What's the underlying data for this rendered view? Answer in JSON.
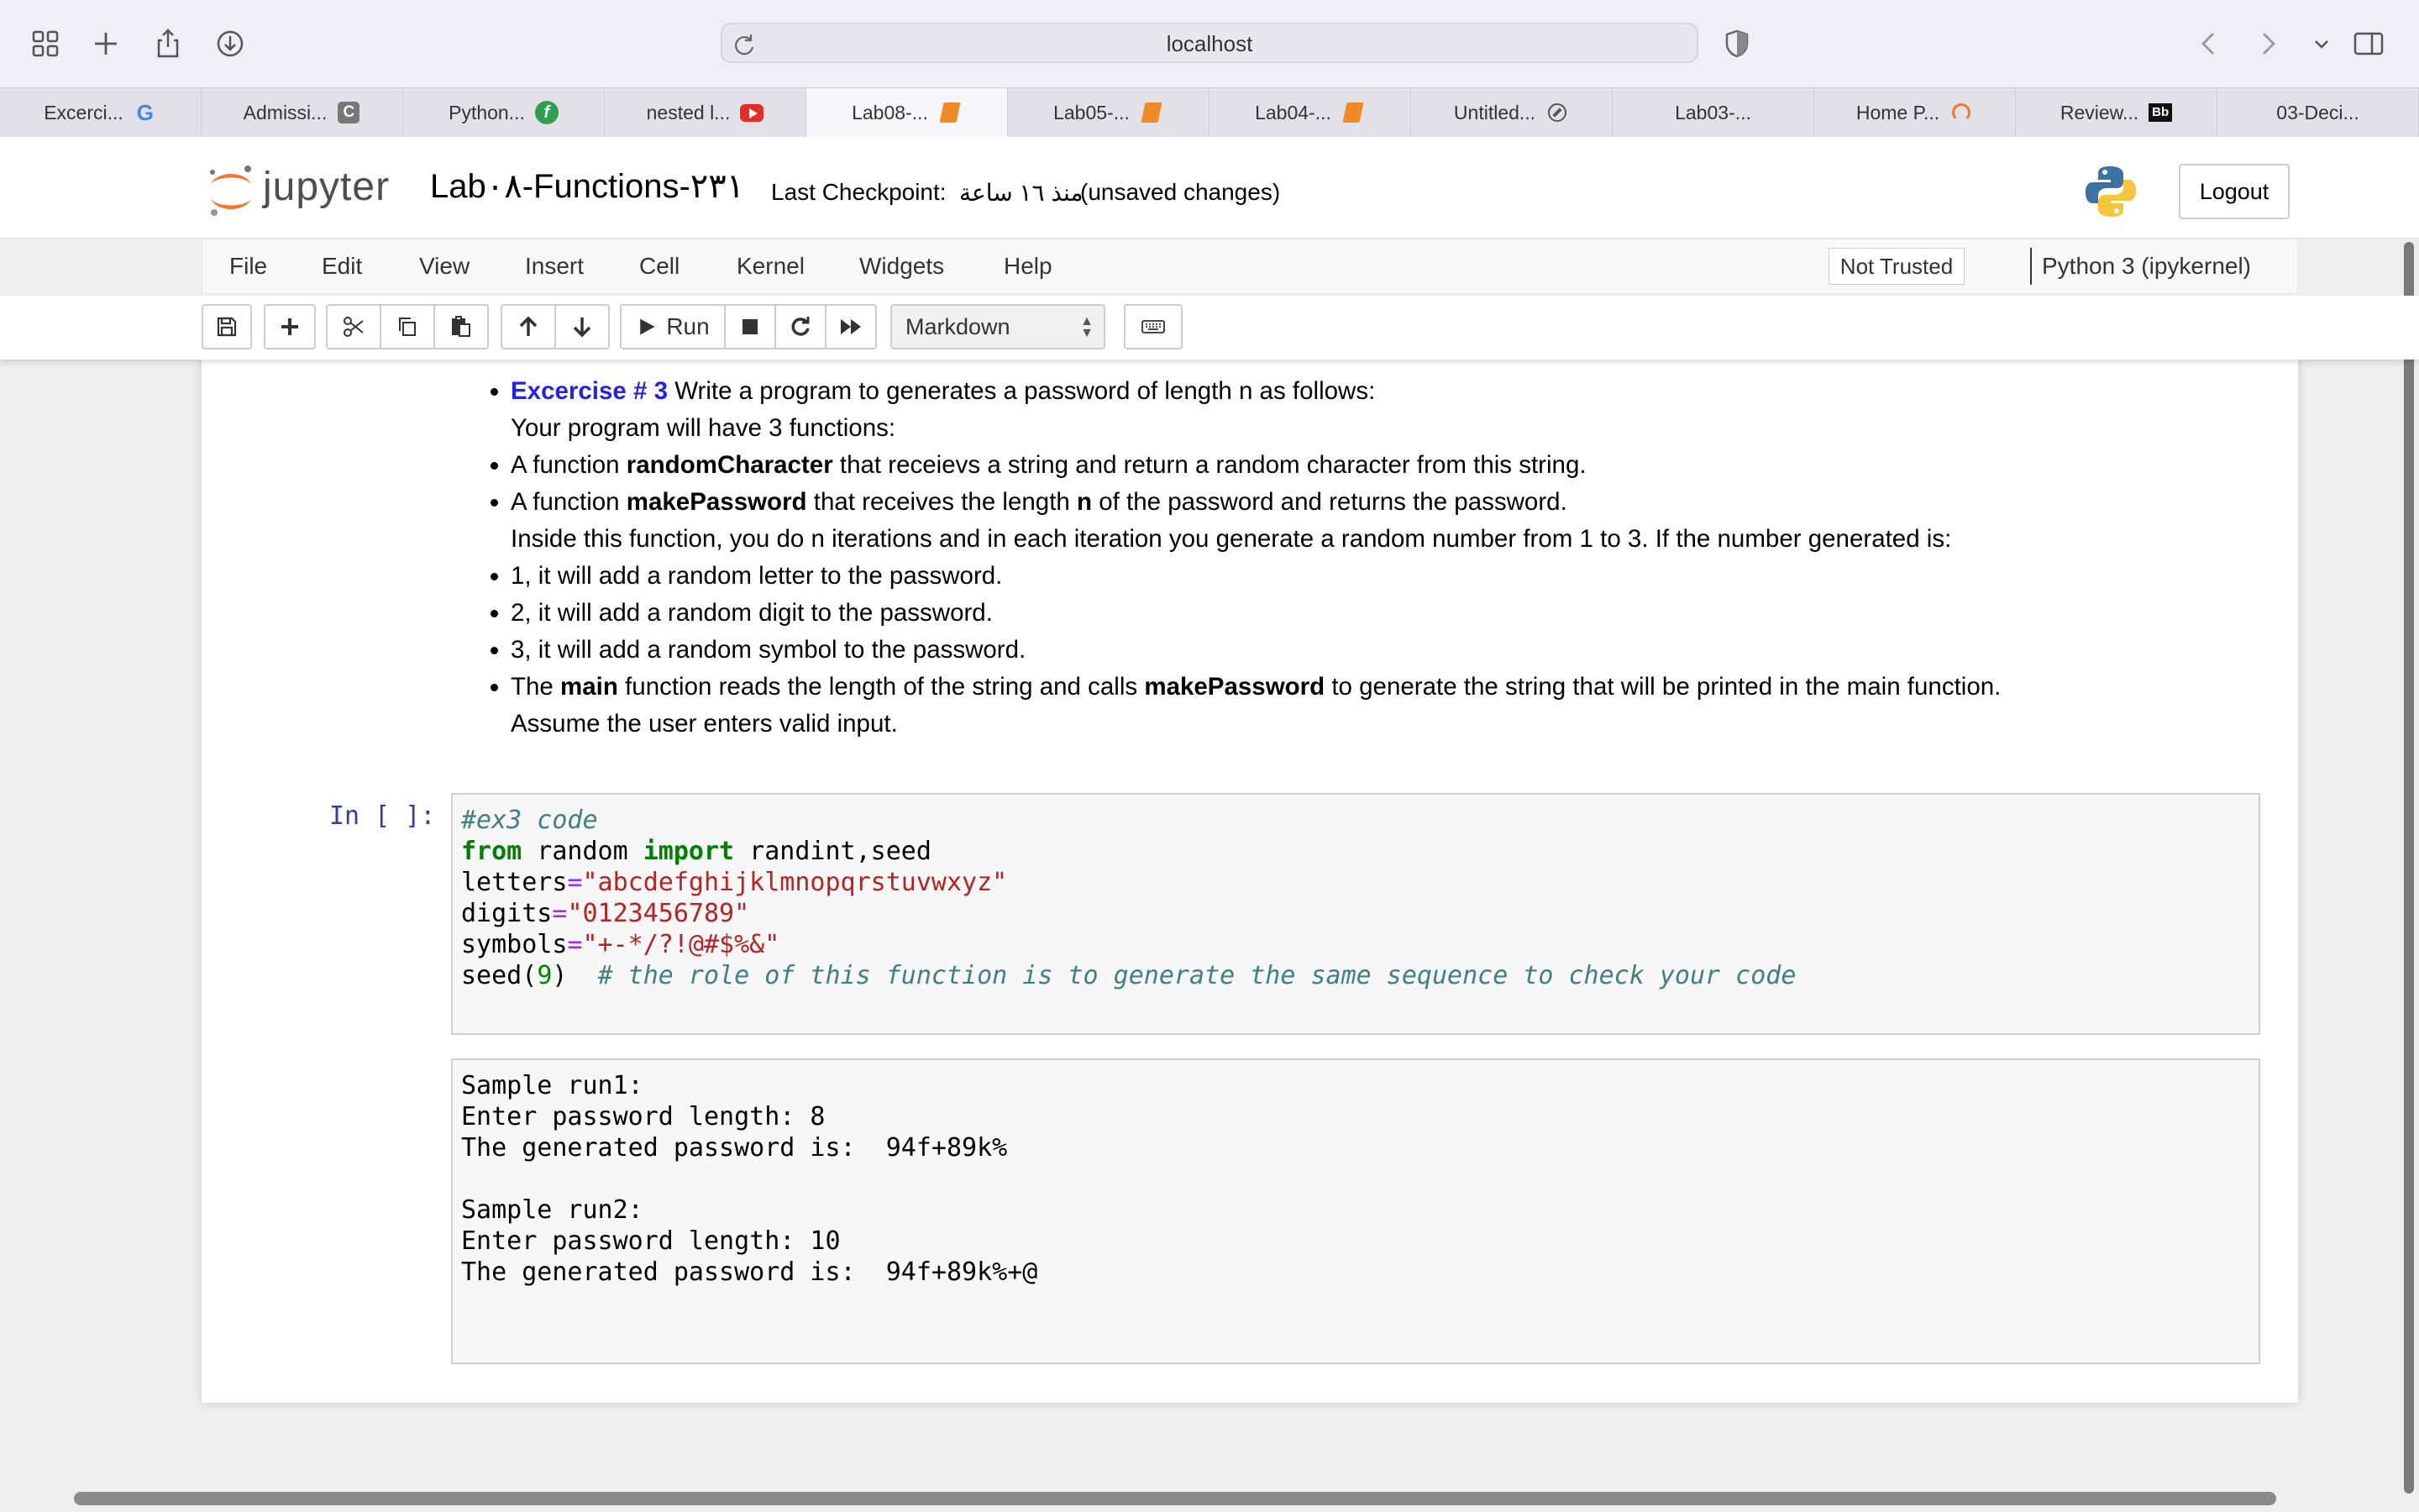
{
  "browser": {
    "address": "localhost",
    "tabs": [
      {
        "label": "Excerci...",
        "icon": "google-icon"
      },
      {
        "label": "Admissi...",
        "icon": "c-icon"
      },
      {
        "label": "Python...",
        "icon": "f-icon"
      },
      {
        "label": "nested l...",
        "icon": "youtube-icon"
      },
      {
        "label": "Lab08-...",
        "icon": "notebook-icon",
        "active": true
      },
      {
        "label": "Lab05-...",
        "icon": "notebook-icon"
      },
      {
        "label": "Lab04-...",
        "icon": "notebook-icon"
      },
      {
        "label": "Untitled...",
        "icon": "compass-icon"
      },
      {
        "label": "Lab03-...",
        "icon": ""
      },
      {
        "label": "Home P...",
        "icon": "loading-icon"
      },
      {
        "label": "Review...",
        "icon": "bb-icon"
      },
      {
        "label": "03-Deci...",
        "icon": ""
      }
    ]
  },
  "header": {
    "logo_text": "jupyter",
    "notebook_name": "Lab٠٨-Functions-٢٣١",
    "checkpoint_label": "Last Checkpoint:",
    "checkpoint_value": "منذ ١٦ ساعة",
    "autosave_status": "(unsaved changes)",
    "logout_label": "Logout"
  },
  "menu": {
    "items": [
      "File",
      "Edit",
      "View",
      "Insert",
      "Cell",
      "Kernel",
      "Widgets",
      "Help"
    ],
    "trust": "Not Trusted",
    "kernel": "Python 3 (ipykernel)"
  },
  "toolbar": {
    "run_label": "Run",
    "cell_type": "Markdown"
  },
  "markdown": {
    "ex_title": "Excercise # 3",
    "ex_intro": " Write a program to generates a password of length n as follows:",
    "ex_intro2": "Your program will have 3 functions:",
    "b1_pre": "A function ",
    "b1_bold": "randomCharacter",
    "b1_post": " that receievs a string and return a random character from this string.",
    "b2_pre": "A function ",
    "b2_bold": "makePassword",
    "b2_mid": " that receives the length ",
    "b2_bold2": "n",
    "b2_post": " of the password and returns the password.",
    "b2_line2": "Inside this function, you do n iterations and in each iteration you generate a random number from 1 to 3. If the number generated is:",
    "b3": "1, it will add a random letter to the password.",
    "b4": "2, it will add a random digit to the password.",
    "b5": "3, it will add a random symbol to the password.",
    "b6_pre": "The ",
    "b6_bold": "main",
    "b6_mid": " function reads the length of the string and calls ",
    "b6_bold2": "makePassword",
    "b6_post": " to generate the string that will be printed in the main function.",
    "b6_line2": "Assume the user enters valid input."
  },
  "code_cell": {
    "prompt": "In [ ]:",
    "l1": "#ex3 code",
    "l2_kw1": "from",
    "l2_mod": " random ",
    "l2_kw2": "import",
    "l2_rest": " randint,seed",
    "l3_var": "letters",
    "l3_eq": "=",
    "l3_str": "\"abcdefghijklmnopqrstuvwxyz\"",
    "l4_var": "digits",
    "l4_eq": "=",
    "l4_str": "\"0123456789\"",
    "l5_var": "symbols",
    "l5_eq": "=",
    "l5_str": "\"+-*/?!@#$%&\"",
    "l6_fn": "seed(",
    "l6_num": "9",
    "l6_close": ")  ",
    "l6_comment": "# the role of this function is to generate the same sequence to check your code"
  },
  "output_cell": {
    "lines": [
      "Sample run1:",
      "Enter password length: 8",
      "The generated password is:  94f+89k%",
      "",
      "Sample run2:",
      "Enter password length: 10",
      "The generated password is:  94f+89k%+@"
    ]
  },
  "colors": {
    "exercise_title": "#2222ee",
    "prompt": "#303f9f",
    "keyword": "#008000",
    "string": "#ba2121"
  }
}
